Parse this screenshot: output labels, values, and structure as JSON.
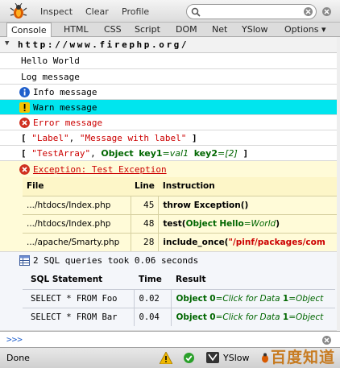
{
  "toolbar": {
    "inspect": "Inspect",
    "clear": "Clear",
    "profile": "Profile"
  },
  "tabs": [
    "Console",
    "HTML",
    "CSS",
    "Script",
    "DOM",
    "Net",
    "YSlow",
    "Options ▾"
  ],
  "console": {
    "group_title": "http://www.firephp.org/",
    "hello": "Hello World",
    "log": "Log message",
    "info": "Info message",
    "warn": "Warn message",
    "error": "Error message",
    "label_row": {
      "open": "[",
      "label": "\"Label\"",
      "comma": ", ",
      "message": "\"Message with label\"",
      "close": "]"
    },
    "array_row": {
      "open": "[",
      "name": "\"TestArray\"",
      "comma": ", ",
      "object": "Object",
      "key1": "key1",
      "eq1": "=",
      "val1": "val1",
      "key2": "key2",
      "eq2": "=",
      "val2": "[2]",
      "close": "]"
    },
    "exception": {
      "title": "Exception: Test Exception",
      "headers": [
        "File",
        "Line",
        "Instruction"
      ],
      "rows": [
        {
          "file": ".../htdocs/Index.php",
          "line": "45",
          "instr": "throw Exception()"
        },
        {
          "file": ".../htdocs/Index.php",
          "line": "48",
          "instr_fn": "test(",
          "instr_obj": "Object",
          "instr_key": "Hello",
          "instr_eq": "=",
          "instr_val": "World",
          "instr_close": ")"
        },
        {
          "file": ".../apache/Smarty.php",
          "line": "28",
          "instr_fn": "include_once(",
          "instr_str": "\"/pinf/packages/com"
        }
      ]
    },
    "sql": {
      "title": "2 SQL queries took 0.06 seconds",
      "headers": [
        "SQL Statement",
        "Time",
        "Result"
      ],
      "rows": [
        {
          "stmt": "SELECT * FROM Foo",
          "time": "0.02",
          "obj": "Object",
          "k0": "0",
          "v0": "Click for Data",
          "k1": "1",
          "v1": "Object"
        },
        {
          "stmt": "SELECT * FROM Bar",
          "time": "0.04",
          "obj": "Object",
          "k0": "0",
          "v0": "Click for Data",
          "k1": "1",
          "v1": "Object"
        }
      ]
    }
  },
  "cmdline": {
    "prompt": ">>>"
  },
  "status": {
    "text": "Done",
    "yslow": "YSlow"
  },
  "watermark": "百度知道",
  "colors": {
    "info_row": "#ffffff",
    "warn_row": "#00e5ee",
    "error_text": "#cc0000",
    "exception_bg": "#fffbd8",
    "green": "#006600",
    "string_red": "#cc0000",
    "link_red": "#cc0000"
  }
}
